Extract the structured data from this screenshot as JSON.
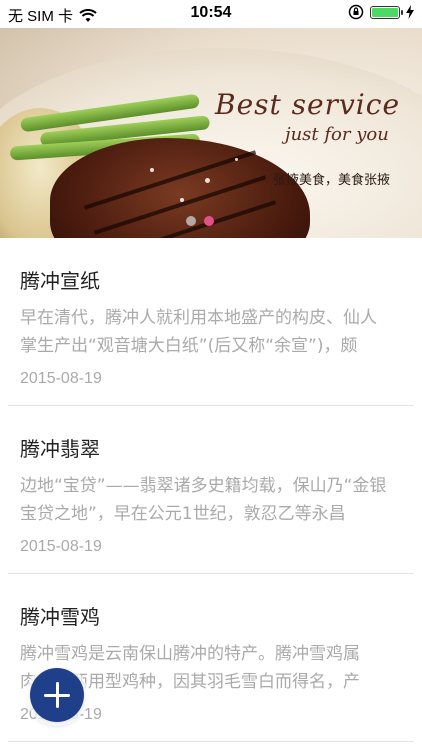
{
  "status_bar": {
    "carrier": "无 SIM 卡",
    "time": "10:54"
  },
  "banner": {
    "script_line1": "Best service",
    "script_line2": "just for you",
    "slogan": "张掖美食，美食张掖",
    "pager": {
      "count": 2,
      "active_index": 1
    }
  },
  "articles": [
    {
      "title": "腾冲宣纸",
      "summary": "早在清代，腾冲人就利用本地盛产的构皮、仙人掌生产出“观音塘大白纸”(后又称“余宣”)，颇",
      "date": "2015-08-19"
    },
    {
      "title": "腾冲翡翠",
      "summary": "边地“宝贷”——翡翠诸多史籍均载，保山乃“金银宝贷之地”，早在公元1世纪，敦忍乙等永昌",
      "date": "2015-08-19"
    },
    {
      "title": "腾冲雪鸡",
      "summary": "腾冲雪鸡是云南保山腾冲的特产。腾冲雪鸡属肉、蛋两用型鸡种，因其羽毛雪白而得名，产",
      "date": "2015-08-19"
    }
  ],
  "fab": {
    "icon": "plus-icon",
    "color": "#1f3f8a"
  },
  "colors": {
    "pager_active": "#e6508a",
    "battery": "#4cd964"
  }
}
